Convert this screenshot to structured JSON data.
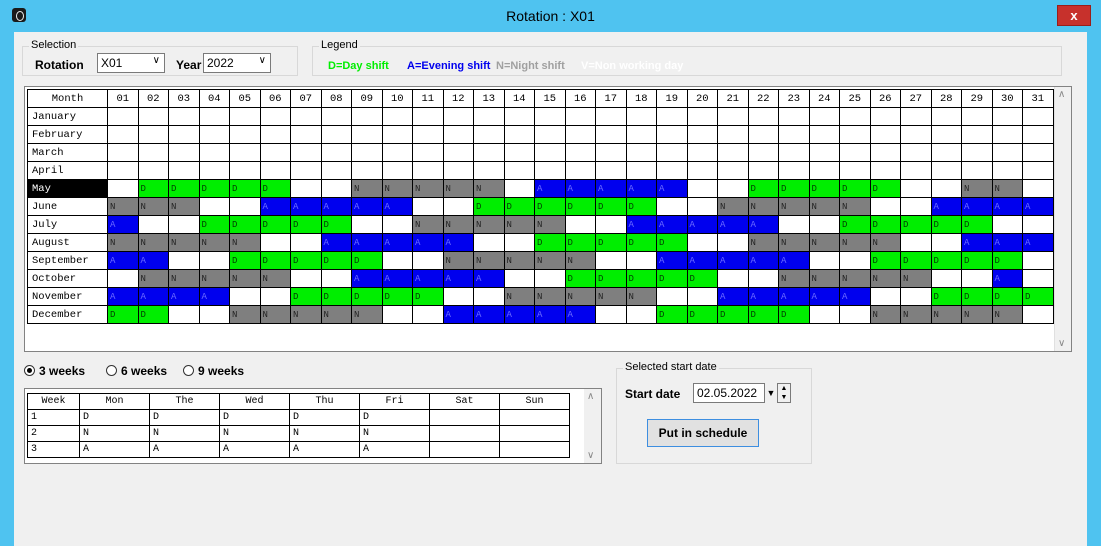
{
  "window": {
    "title": "Rotation : X01",
    "close": "x"
  },
  "selection": {
    "title": "Selection",
    "rotation_label": "Rotation",
    "rotation_value": "X01",
    "year_label": "Year",
    "year_value": "2022"
  },
  "legend": {
    "title": "Legend",
    "items": [
      {
        "text": "D=Day shift",
        "color": "#00ee00"
      },
      {
        "text": "A=Evening shift",
        "color": "#0000ee"
      },
      {
        "text": "N=Night shift",
        "color": "#a0a0a0"
      },
      {
        "text": "V=Non working day",
        "color": "#ffffff"
      }
    ]
  },
  "month_grid": {
    "header_month": "Month",
    "days": [
      "01",
      "02",
      "03",
      "04",
      "05",
      "06",
      "07",
      "08",
      "09",
      "10",
      "11",
      "12",
      "13",
      "14",
      "15",
      "16",
      "17",
      "18",
      "19",
      "20",
      "21",
      "22",
      "23",
      "24",
      "25",
      "26",
      "27",
      "28",
      "29",
      "30",
      "31"
    ],
    "selected_month_index": 4,
    "months": [
      {
        "name": "January",
        "cells": ""
      },
      {
        "name": "February",
        "cells": ""
      },
      {
        "name": "March",
        "cells": ""
      },
      {
        "name": "April",
        "cells": ""
      },
      {
        "name": "May",
        "cells": " DDDDD  NNNNN AAAAA  DDDDD  NN"
      },
      {
        "name": "June",
        "cells": "NNN  AAAAA  DDDDDD  NNNNN  AAAAA"
      },
      {
        "name": "July",
        "cells": "A  DDDDD  NNNNN  AAAAA  DDDDD  "
      },
      {
        "name": "August",
        "cells": "NNNNN  AAAAA  DDDDD  NNNNN  AAA"
      },
      {
        "name": "September",
        "cells": "AA  DDDDD  NNNNN  AAAAA  DDDDD "
      },
      {
        "name": "October",
        "cells": " NNNNN  AAAAA  DDDDD  NNNNN  A"
      },
      {
        "name": "November",
        "cells": "AAAA  DDDDD  NNNNN  AAAAA  DDDD"
      },
      {
        "name": "December",
        "cells": "DD  NNNNN  AAAAA  DDDDD  NNNNN "
      }
    ]
  },
  "weeks_options": [
    {
      "label": "3 weeks",
      "selected": true
    },
    {
      "label": "6 weeks",
      "selected": false
    },
    {
      "label": "9 weeks",
      "selected": false
    }
  ],
  "week_table": {
    "headers": [
      "Week",
      "Mon",
      "The",
      "Wed",
      "Thu",
      "Fri",
      "Sat",
      "Sun"
    ],
    "rows": [
      [
        "1",
        "D",
        "D",
        "D",
        "D",
        "D",
        "",
        ""
      ],
      [
        "2",
        "N",
        "N",
        "N",
        "N",
        "N",
        "",
        ""
      ],
      [
        "3",
        "A",
        "A",
        "A",
        "A",
        "A",
        "",
        ""
      ]
    ]
  },
  "start": {
    "group_title": "Selected start date",
    "label": "Start date",
    "value": "02.05.2022",
    "button": "Put in schedule"
  }
}
